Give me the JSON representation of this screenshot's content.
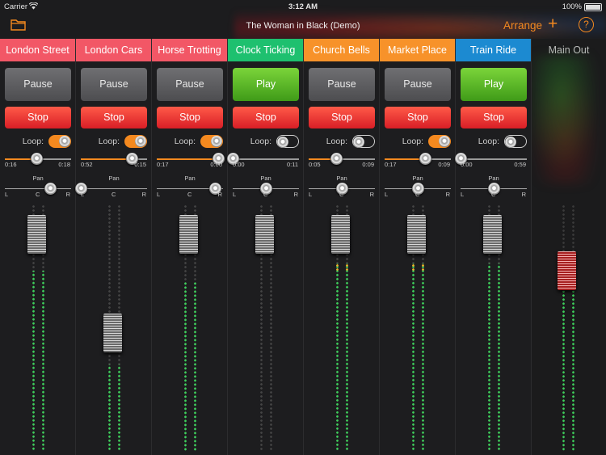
{
  "status_bar": {
    "carrier": "Carrier",
    "time": "3:12 AM",
    "battery": "100%"
  },
  "toolbar": {
    "title": "The Woman in Black (Demo)",
    "arrange_label": "Arrange",
    "add_label": "+",
    "help_label": "?"
  },
  "colors": {
    "accent": "#f4891f",
    "play": "#4fae22",
    "stop": "#e8312f",
    "meter": "#3bd35a"
  },
  "main_out": {
    "label": "Main Out",
    "level": 0.77,
    "meter_left": 0.65,
    "meter_right": 0.65
  },
  "channels": [
    {
      "name": "London Street",
      "color": "#f25766",
      "button": "Pause",
      "stop": "Stop",
      "loop_label": "Loop:",
      "loop": true,
      "progress": 0.47,
      "time_elapsed": "0:16",
      "time_remaining": "0:18",
      "pan_label": "Pan",
      "pan_left": "L",
      "pan_center": "C",
      "pan_right": "R",
      "pan": 0.68,
      "level": 0.95,
      "meter_left": 0.73,
      "meter_right": 0.73,
      "meter_yellow": 0
    },
    {
      "name": "London Cars",
      "color": "#f25766",
      "button": "Pause",
      "stop": "Stop",
      "loop_label": "Loop:",
      "loop": true,
      "progress": 0.77,
      "time_elapsed": "0:52",
      "time_remaining": "0:15",
      "pan_label": "Pan",
      "pan_left": "L",
      "pan_center": "C",
      "pan_right": "R",
      "pan": 0.0,
      "level": 0.46,
      "meter_left": 0.35,
      "meter_right": 0.35,
      "meter_yellow": 0
    },
    {
      "name": "Horse Trotting",
      "color": "#f25766",
      "button": "Pause",
      "stop": "Stop",
      "loop_label": "Loop:",
      "loop": true,
      "progress": 0.93,
      "time_elapsed": "0:17",
      "time_remaining": "0:00",
      "pan_label": "Pan",
      "pan_left": "L",
      "pan_center": "C",
      "pan_right": "R",
      "pan": 0.88,
      "level": 0.95,
      "meter_left": 0.69,
      "meter_right": 0.69,
      "meter_yellow": 0
    },
    {
      "name": "Clock Ticking",
      "color": "#1ec06f",
      "button": "Play",
      "stop": "Stop",
      "loop_label": "Loop:",
      "loop": false,
      "progress": 0.0,
      "time_elapsed": "0:00",
      "time_remaining": "0:11",
      "pan_label": "Pan",
      "pan_left": "L",
      "pan_center": "C",
      "pan_right": "R",
      "pan": 0.5,
      "level": 0.95,
      "meter_left": 0.0,
      "meter_right": 0.0,
      "meter_yellow": 0
    },
    {
      "name": "Church Bells",
      "color": "#f7922a",
      "button": "Pause",
      "stop": "Stop",
      "loop_label": "Loop:",
      "loop": false,
      "progress": 0.41,
      "time_elapsed": "0:05",
      "time_remaining": "0:09",
      "pan_label": "Pan",
      "pan_left": "L",
      "pan_center": "C",
      "pan_right": "R",
      "pan": 0.5,
      "level": 0.95,
      "meter_left": 0.76,
      "meter_right": 0.76,
      "meter_yellow": 2
    },
    {
      "name": "Market Place",
      "color": "#f7922a",
      "button": "Pause",
      "stop": "Stop",
      "loop_label": "Loop:",
      "loop": true,
      "progress": 0.61,
      "time_elapsed": "0:17",
      "time_remaining": "0:09",
      "pan_label": "Pan",
      "pan_left": "L",
      "pan_center": "C",
      "pan_right": "R",
      "pan": 0.5,
      "level": 0.95,
      "meter_left": 0.76,
      "meter_right": 0.76,
      "meter_yellow": 2
    },
    {
      "name": "Train Ride",
      "color": "#1c8ad1",
      "button": "Play",
      "stop": "Stop",
      "loop_label": "Loop:",
      "loop": false,
      "progress": 0.0,
      "time_elapsed": "0:00",
      "time_remaining": "0:59",
      "pan_label": "Pan",
      "pan_left": "L",
      "pan_center": "C",
      "pan_right": "R",
      "pan": 0.5,
      "level": 0.95,
      "meter_left": 0.76,
      "meter_right": 0.76,
      "meter_yellow": 0
    }
  ]
}
